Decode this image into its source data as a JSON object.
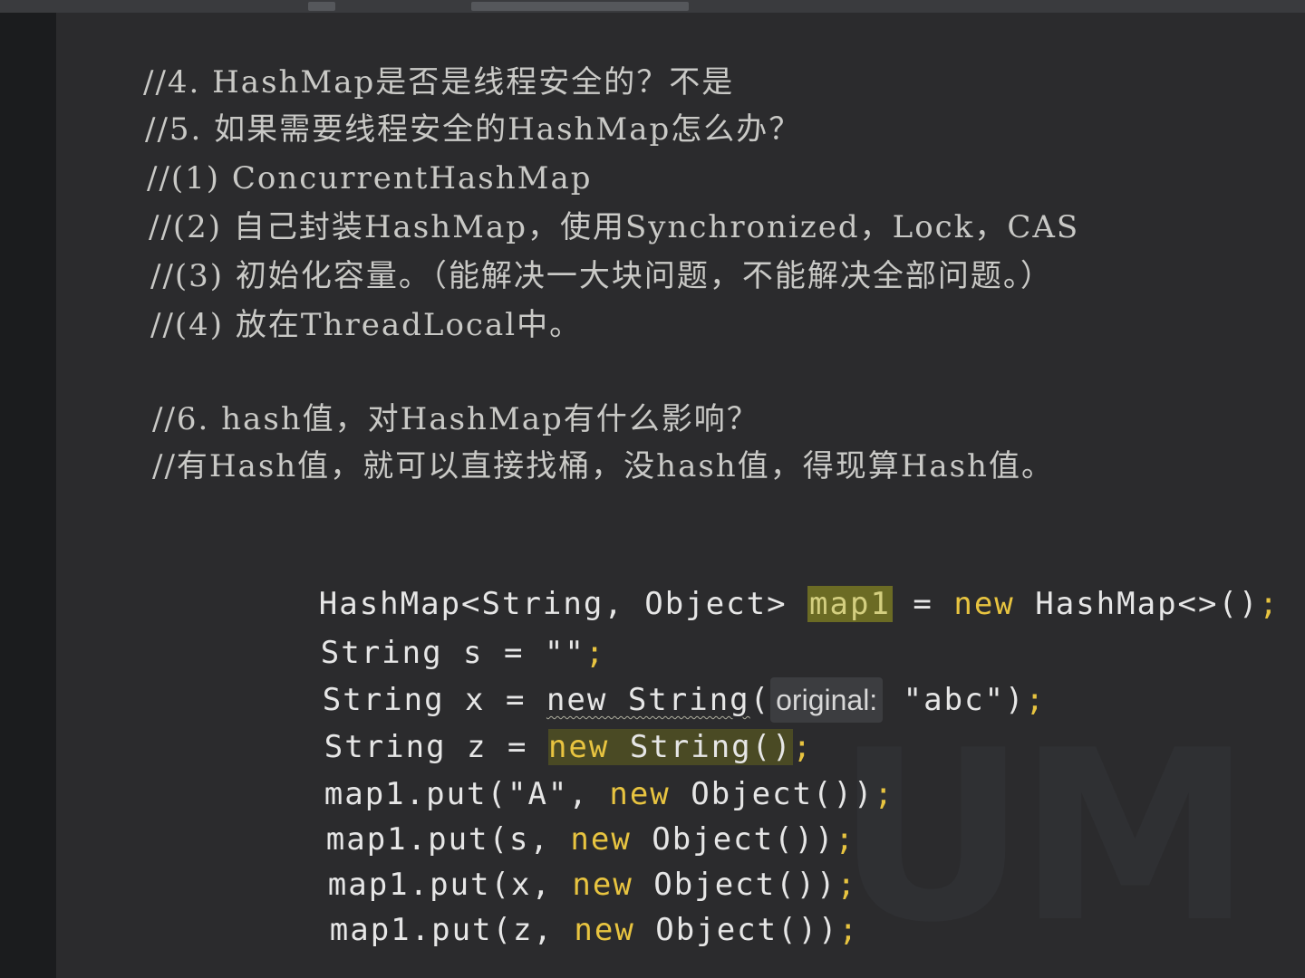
{
  "comments": {
    "c1": "//4. HashMap是否是线程安全的？不是",
    "c2": "//5. 如果需要线程安全的HashMap怎么办？",
    "c3": "//(1) ConcurrentHashMap",
    "c4": "//(2) 自己封装HashMap，使用Synchronized，Lock，CAS",
    "c5": "//(3) 初始化容量。（能解决一大块问题，不能解决全部问题。）",
    "c6": "//(4) 放在ThreadLocal中。",
    "c7": "//6. hash值，对HashMap有什么影响？",
    "c8": "//有Hash值，就可以直接找桶，没hash值，得现算Hash值。"
  },
  "code": {
    "l1": {
      "type": "HashMap<String, Object> ",
      "var": "map1",
      "eq": " = ",
      "kw": "new",
      "rest": " HashMap<>()",
      "semi": ";"
    },
    "l2": {
      "pre": "String s = ",
      "str": "\"\"",
      "semi": ";"
    },
    "l3": {
      "pre": "String x = ",
      "ctor": "new String",
      "open": "(",
      "hint": "original:",
      "str": " \"abc\")",
      "semi": ";"
    },
    "l4": {
      "pre": "String z = ",
      "kw": "new",
      "ctor": " String()",
      "semi": ";"
    },
    "l5": {
      "pre": "map1.put(\"A\", ",
      "kw": "new",
      "rest": " Object())",
      "semi": ";"
    },
    "l6": {
      "pre": "map1.put(s, ",
      "kw": "new",
      "rest": " Object())",
      "semi": ";"
    },
    "l7": {
      "pre": "map1.put(x, ",
      "kw": "new",
      "rest": " Object())",
      "semi": ";"
    },
    "l8": {
      "pre": "map1.put(z, ",
      "kw": "new",
      "rest": " Object())",
      "semi": ";"
    }
  }
}
